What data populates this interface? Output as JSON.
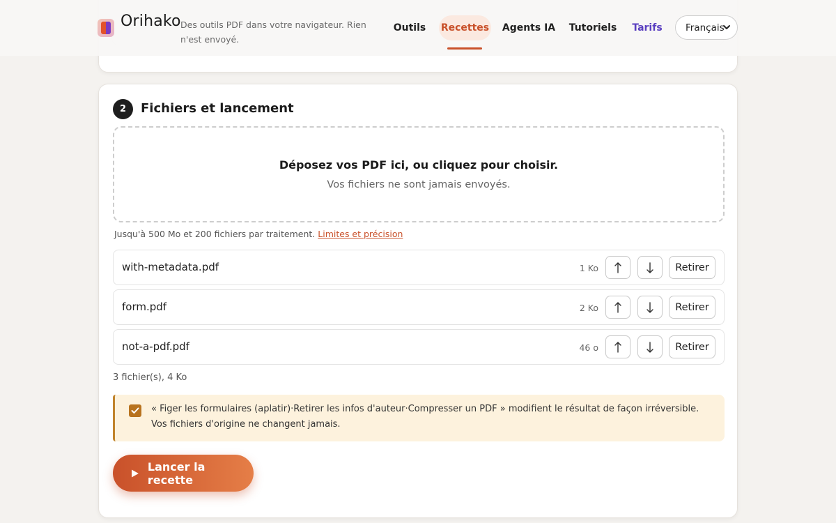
{
  "header": {
    "brand": "Orihako",
    "tagline": "Des outils PDF dans votre navigateur. Rien n'est envoyé.",
    "nav": [
      {
        "label": "Outils"
      },
      {
        "label": "Recettes"
      },
      {
        "label": "Agents IA"
      },
      {
        "label": "Tutoriels"
      },
      {
        "label": "Tarifs"
      }
    ],
    "active_nav": "Recettes",
    "language": "Français"
  },
  "section": {
    "step": "2",
    "title": "Fichiers et lancement",
    "dropzone": {
      "main": "Déposez vos PDF ici, ou cliquez pour choisir.",
      "sub": "Vos fichiers ne sont jamais envoyés."
    },
    "limits_text": "Jusqu'à 500 Mo et 200 fichiers par traitement.",
    "limits_link": "Limites et précision",
    "files": [
      {
        "name": "with-metadata.pdf",
        "size": "1 Ko"
      },
      {
        "name": "form.pdf",
        "size": "2 Ko"
      },
      {
        "name": "not-a-pdf.pdf",
        "size": "46 o"
      }
    ],
    "remove_label": "Retirer",
    "up_symbol": "↑",
    "down_symbol": "↓",
    "summary": "3 fichier(s), 4 Ko",
    "notice": "« Figer les formulaires (aplatir)·Retirer les infos d'auteur·Compresser un PDF » modifient le résultat de façon irréversible. Vos fichiers d'origine ne changent jamais.",
    "notice_checked": true,
    "run_label": "Lancer la recette"
  },
  "colors": {
    "accent": "#c9512a",
    "tarifs": "#5a3fc0",
    "notice_bg": "#fdf2dd",
    "notice_border": "#c0832b"
  }
}
